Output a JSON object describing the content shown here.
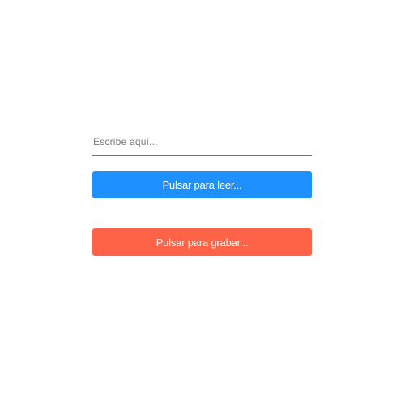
{
  "input": {
    "value": "",
    "placeholder": "Escribe aquí..."
  },
  "buttons": {
    "read_label": "Pulsar para leer...",
    "record_label": "Pulsar para grabar..."
  },
  "colors": {
    "read_button": "#1e90ff",
    "record_button": "#ff6347",
    "input_underline": "#3b73e0"
  }
}
